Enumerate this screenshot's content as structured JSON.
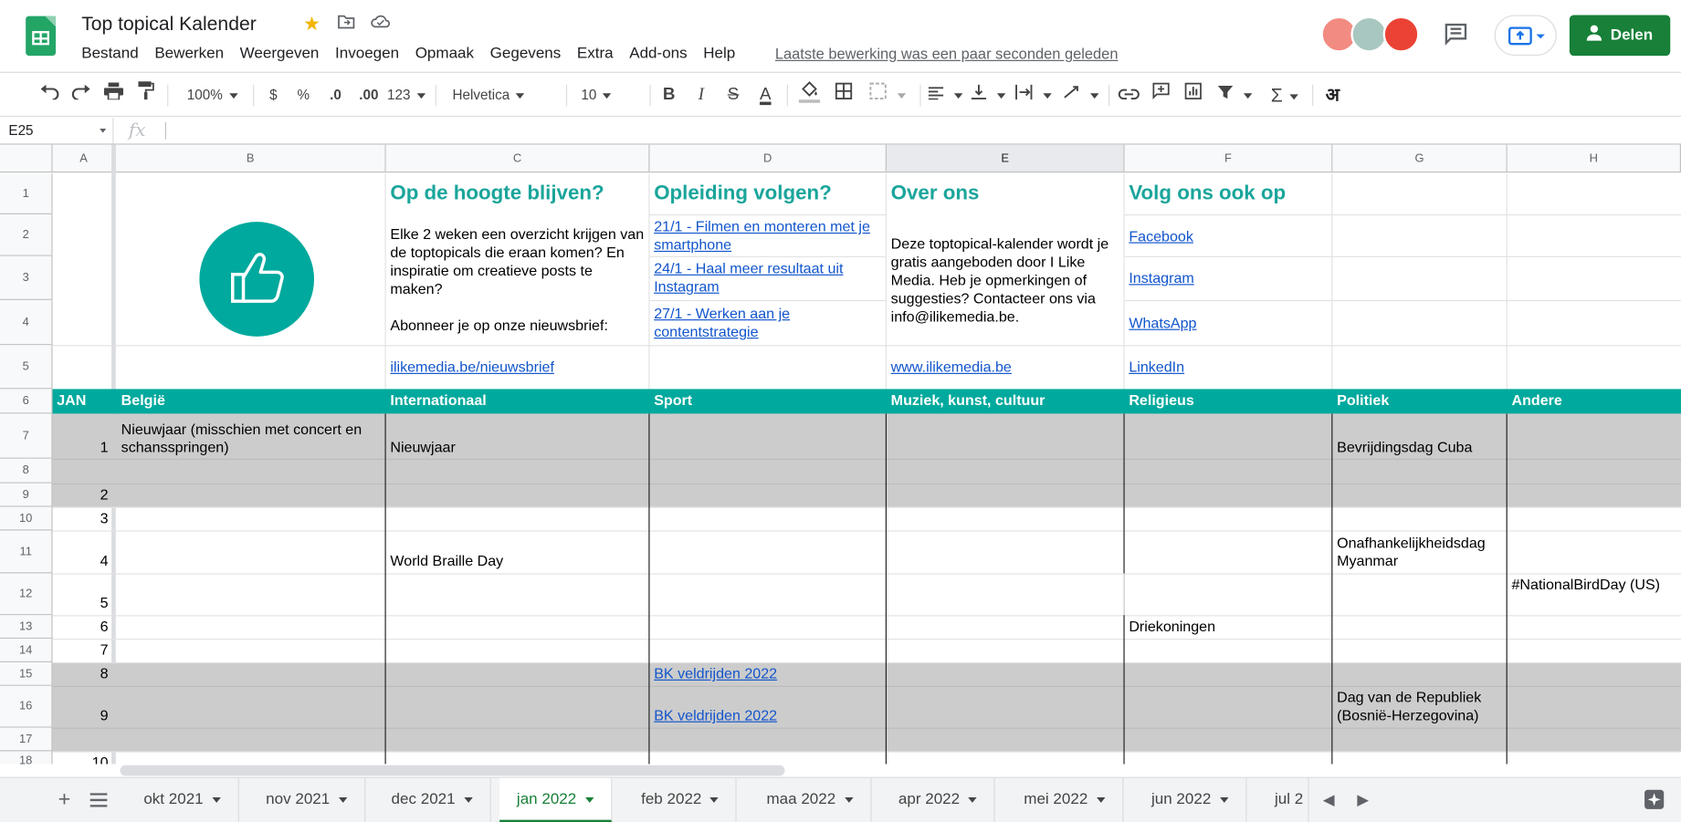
{
  "header": {
    "title": "Top topical Kalender",
    "last_edit": "Laatste bewerking was een paar seconden geleden",
    "share_label": "Delen",
    "menu": [
      "Bestand",
      "Bewerken",
      "Weergeven",
      "Invoegen",
      "Opmaak",
      "Gegevens",
      "Extra",
      "Add-ons",
      "Help"
    ]
  },
  "toolbar": {
    "zoom": "100%",
    "currency": "$",
    "percent": "%",
    "dec_less": ".0",
    "dec_more": ".00",
    "format_more": "123",
    "font": "Helvetica",
    "font_size": "10",
    "bold": "B",
    "italic": "I",
    "strike": "S",
    "text_color": "A",
    "input_tools": "अ"
  },
  "formula_bar": {
    "cell_ref": "E25",
    "fx": "fx"
  },
  "columns": [
    "A",
    "B",
    "C",
    "D",
    "E",
    "F",
    "G",
    "H"
  ],
  "rows": [
    "1",
    "2",
    "3",
    "4",
    "5",
    "6",
    "7",
    "8",
    "9",
    "10",
    "11",
    "12",
    "13",
    "14",
    "15",
    "16",
    "17",
    "18"
  ],
  "top": {
    "c_title": "Op de hoogte blijven?",
    "d_title": "Opleiding volgen?",
    "e_title": "Over ons",
    "f_title": "Volg ons ook op",
    "c_text": "Elke 2 weken een overzicht krijgen van de toptopicals die eraan komen? En inspiratie om creatieve posts te maken?",
    "c_text2": "Abonneer je op onze nieuwsbrief:",
    "c_link": "ilikemedia.be/nieuwsbrief",
    "d_link1": "21/1 - Filmen en monteren met je smartphone",
    "d_link2": "24/1 - Haal meer resultaat uit Instagram",
    "d_link3": "27/1 - Werken aan je contentstrategie",
    "e_text": "Deze toptopical-kalender wordt je gratis aangeboden door I Like Media. Heb je opmerkingen of suggesties? Contacteer ons via info@ilikemedia.be.",
    "e_link": "www.ilikemedia.be",
    "f_facebook": "Facebook",
    "f_instagram": "Instagram",
    "f_whatsapp": "WhatsApp",
    "f_linkedin": "LinkedIn"
  },
  "band": {
    "a": "JAN",
    "b": "België",
    "c": "Internationaal",
    "d": "Sport",
    "e": "Muziek, kunst, cultuur",
    "f": "Religieus",
    "g": "Politiek",
    "h": "Andere"
  },
  "cells": {
    "a7": "1",
    "b7": "Nieuwjaar (misschien met concert en schansspringen)",
    "c7": "Nieuwjaar",
    "g7": "Bevrijdingsdag Cuba",
    "a9": "2",
    "a10": "3",
    "a11": "4",
    "c11": "World Braille Day",
    "g11": "Onafhankelijkheidsdag Myanmar",
    "a12": "5",
    "h12": "#NationalBirdDay (US)",
    "a13": "6",
    "f13": "Driekoningen",
    "a14": "7",
    "a15": "8",
    "d15": "BK veldrijden 2022",
    "a16": "9",
    "d16": "BK veldrijden 2022",
    "g16": "Dag van de Republiek (Bosnië-Herzegovina)",
    "a18": "10"
  },
  "sheets": [
    "okt 2021",
    "nov 2021",
    "dec 2021",
    "jan 2022",
    "feb 2022",
    "maa 2022",
    "apr 2022",
    "mei 2022",
    "jun 2022",
    "jul 2"
  ],
  "active_sheet": "jan 2022",
  "colors": {
    "teal": "#00a99d",
    "green": "#188038",
    "gray_row": "#cccccc",
    "link": "#1155cc"
  }
}
